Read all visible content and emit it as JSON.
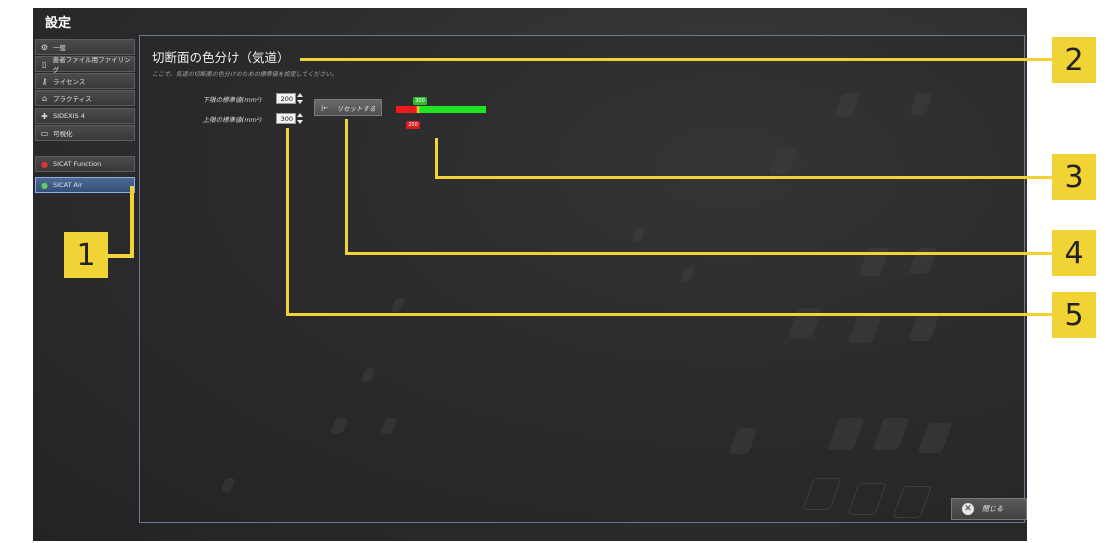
{
  "window": {
    "title": "設定"
  },
  "sidebar": {
    "items": [
      {
        "label": "一般",
        "icon": "gears-icon",
        "active": false
      },
      {
        "label": "患者ファイル用ファイリング",
        "icon": "filing-icon",
        "active": false
      },
      {
        "label": "ライセンス",
        "icon": "key-icon",
        "active": false
      },
      {
        "label": "プラクティス",
        "icon": "house-icon",
        "active": false
      },
      {
        "label": "SIDEXIS 4",
        "icon": "puzzle-icon",
        "active": false
      },
      {
        "label": "可視化",
        "icon": "monitor-icon",
        "active": false
      },
      {
        "label": "SICAT Function",
        "icon": "function-icon",
        "active": false
      },
      {
        "label": "SICAT Air",
        "icon": "air-icon",
        "active": true
      }
    ]
  },
  "main": {
    "title": "切断面の色分け（気道）",
    "subtitle": "ここで、気道の切断面の色分けのための標準値を設定してください。",
    "lower_label": "下限の標準値(mm²)",
    "lower_value": "200",
    "upper_label": "上限の標準値(mm²)",
    "upper_value": "300",
    "reset_label": "リセットする",
    "scale": {
      "upper_marker": "300",
      "lower_marker": "200"
    }
  },
  "footer": {
    "close_label": "閉じる"
  },
  "callouts": [
    "1",
    "2",
    "3",
    "4",
    "5"
  ],
  "colors": {
    "callout": "#f2d335",
    "red": "#ee1b1b",
    "green": "#22e322",
    "active_nav": "#4c6a93"
  }
}
